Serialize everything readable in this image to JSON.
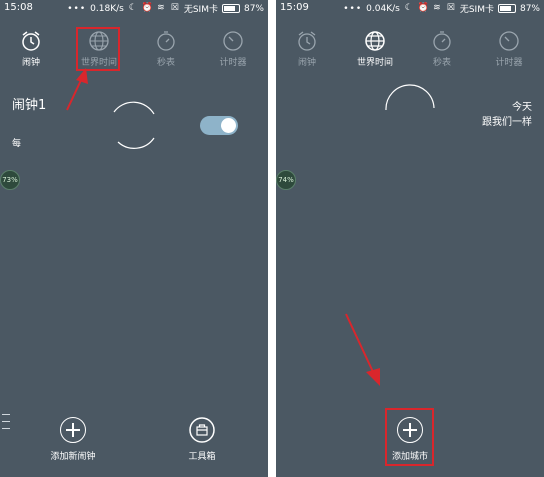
{
  "left": {
    "status": {
      "time": "15:08",
      "speed": "0.18K/s",
      "sim": "无SIM卡",
      "battery": "87%"
    },
    "tabs": [
      {
        "label": "闹钟",
        "icon": "alarm-clock-icon"
      },
      {
        "label": "世界时间",
        "icon": "globe-icon"
      },
      {
        "label": "秒表",
        "icon": "stopwatch-icon"
      },
      {
        "label": "计时器",
        "icon": "timer-icon"
      }
    ],
    "alarm": {
      "name": "闹钟1",
      "repeat": "每",
      "enabled": true
    },
    "badge": "73%",
    "actions": {
      "add_alarm": "添加新闹钟",
      "toolbox": "工具箱"
    }
  },
  "right": {
    "status": {
      "time": "15:09",
      "speed": "0.04K/s",
      "sim": "无SIM卡",
      "battery": "87%"
    },
    "tabs": [
      {
        "label": "闹钟",
        "icon": "alarm-clock-icon"
      },
      {
        "label": "世界时间",
        "icon": "globe-icon"
      },
      {
        "label": "秒表",
        "icon": "stopwatch-icon"
      },
      {
        "label": "计时器",
        "icon": "timer-icon"
      }
    ],
    "today_line1": "今天",
    "today_line2": "跟我们一样",
    "badge": "74%",
    "actions": {
      "add_city": "添加城市"
    }
  },
  "colors": {
    "screen_bg": "#4b5863",
    "highlight": "#d9262c",
    "toggle_on": "#8eb3c9"
  }
}
